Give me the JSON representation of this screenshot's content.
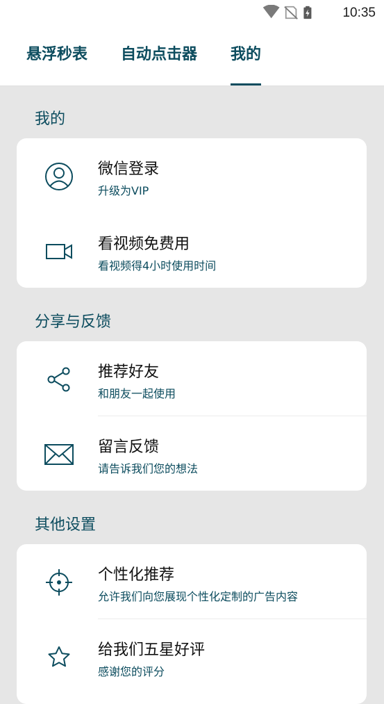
{
  "status_bar": {
    "time": "10:35"
  },
  "tabs": [
    {
      "label": "悬浮秒表"
    },
    {
      "label": "自动点击器"
    },
    {
      "label": "我的"
    }
  ],
  "sections": [
    {
      "title": "我的",
      "items": [
        {
          "title": "微信登录",
          "subtitle": "升级为VIP",
          "icon": "user-circle-icon"
        },
        {
          "title": "看视频免费用",
          "subtitle": "看视频得4小时使用时间",
          "icon": "video-camera-icon"
        }
      ]
    },
    {
      "title": "分享与反馈",
      "items": [
        {
          "title": "推荐好友",
          "subtitle": "和朋友一起使用",
          "icon": "share-icon"
        },
        {
          "title": "留言反馈",
          "subtitle": "请告诉我们您的想法",
          "icon": "mail-icon"
        }
      ]
    },
    {
      "title": "其他设置",
      "items": [
        {
          "title": "个性化推荐",
          "subtitle": "允许我们向您展现个性化定制的广告内容",
          "icon": "crosshair-icon"
        },
        {
          "title": "给我们五星好评",
          "subtitle": "感谢您的评分",
          "icon": "star-icon"
        }
      ]
    }
  ],
  "colors": {
    "accent": "#0c4c5e",
    "background": "#e6e6e6",
    "card": "#ffffff"
  }
}
